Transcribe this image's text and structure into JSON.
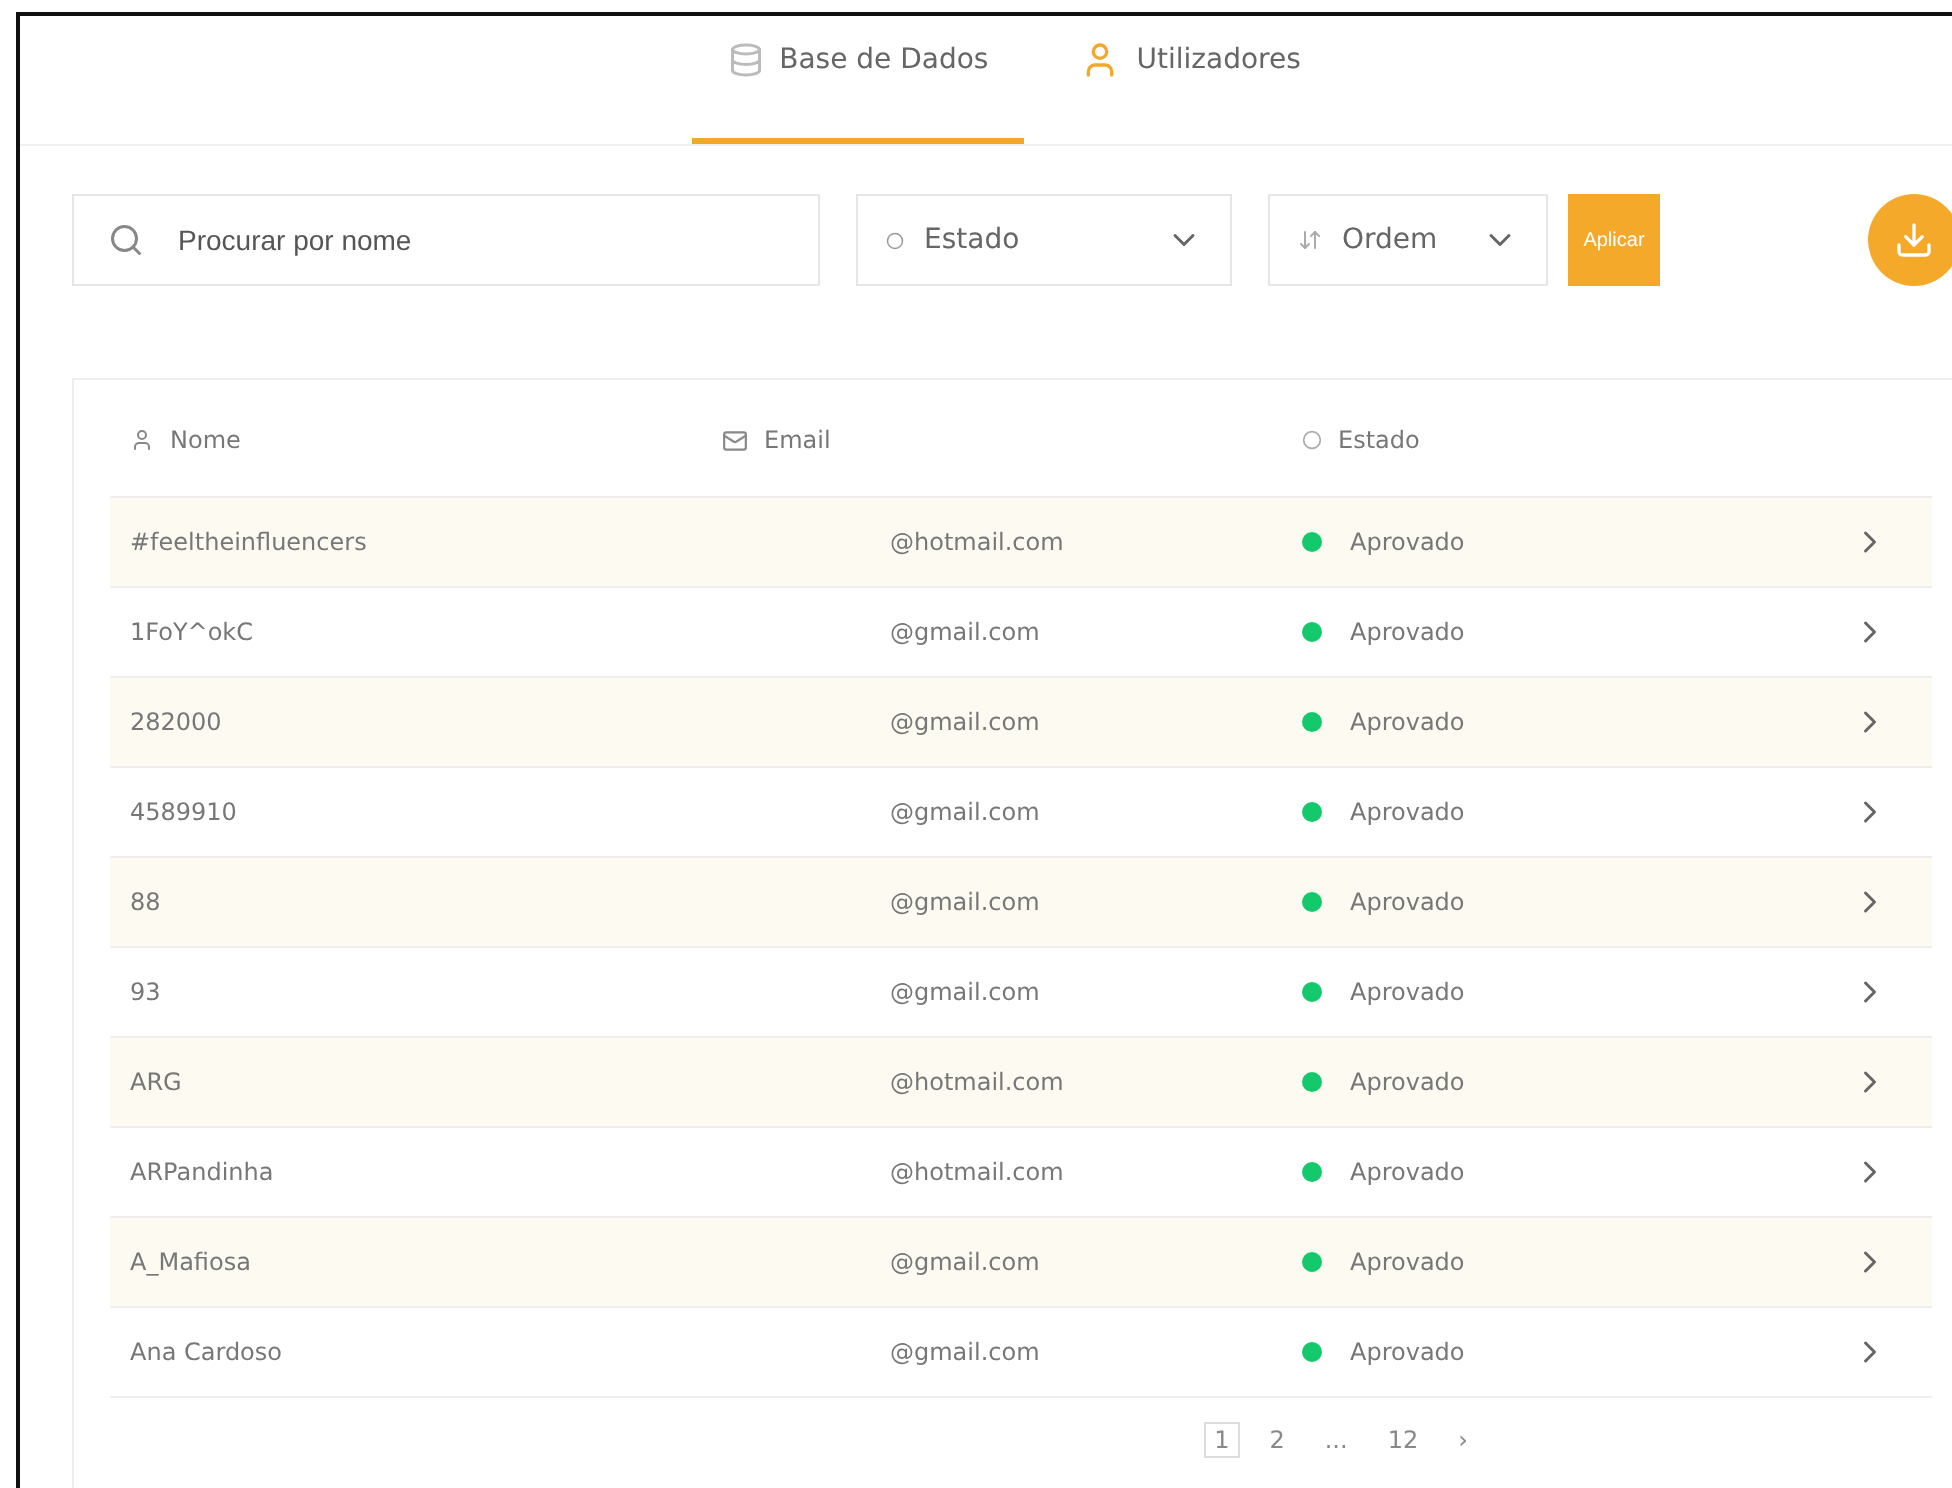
{
  "tabs": [
    {
      "label": "Base de Dados",
      "selected": true
    },
    {
      "label": "Utilizadores",
      "selected": false
    }
  ],
  "search": {
    "placeholder": "Procurar por nome"
  },
  "filters": [
    {
      "label": "Estado",
      "kind": "status"
    },
    {
      "label": "Ordem",
      "kind": "sort"
    }
  ],
  "apply_button": "Aplicar",
  "table": {
    "columns": [
      {
        "label": "Nome",
        "kind": "user"
      },
      {
        "label": "Email",
        "kind": "mail"
      },
      {
        "label": "Estado",
        "kind": "status"
      }
    ],
    "rows": [
      {
        "name": "#feeltheinfluencers",
        "email": "@hotmail.com",
        "status": "Aprovado",
        "color": "#14c96b"
      },
      {
        "name": "1FoY^okC",
        "email": "@gmail.com",
        "status": "Aprovado",
        "color": "#14c96b"
      },
      {
        "name": "282000",
        "email": "@gmail.com",
        "status": "Aprovado",
        "color": "#14c96b"
      },
      {
        "name": "4589910",
        "email": "@gmail.com",
        "status": "Aprovado",
        "color": "#14c96b"
      },
      {
        "name": "88",
        "email": "@gmail.com",
        "status": "Aprovado",
        "color": "#14c96b"
      },
      {
        "name": "93",
        "email": "@gmail.com",
        "status": "Aprovado",
        "color": "#14c96b"
      },
      {
        "name": "ARG",
        "email": "@hotmail.com",
        "status": "Aprovado",
        "color": "#14c96b"
      },
      {
        "name": "ARPandinha",
        "email": "@hotmail.com",
        "status": "Aprovado",
        "color": "#14c96b"
      },
      {
        "name": "A_Mafiosa",
        "email": "@gmail.com",
        "status": "Aprovado",
        "color": "#14c96b"
      },
      {
        "name": "Ana Cardoso",
        "email": "@gmail.com",
        "status": "Aprovado",
        "color": "#14c96b"
      }
    ]
  },
  "pagination": {
    "pages": [
      {
        "label": "1",
        "selected": true
      },
      {
        "label": "2",
        "selected": false
      },
      {
        "label": "...",
        "selected": false
      },
      {
        "label": "12",
        "selected": false
      }
    ],
    "next": "›"
  }
}
